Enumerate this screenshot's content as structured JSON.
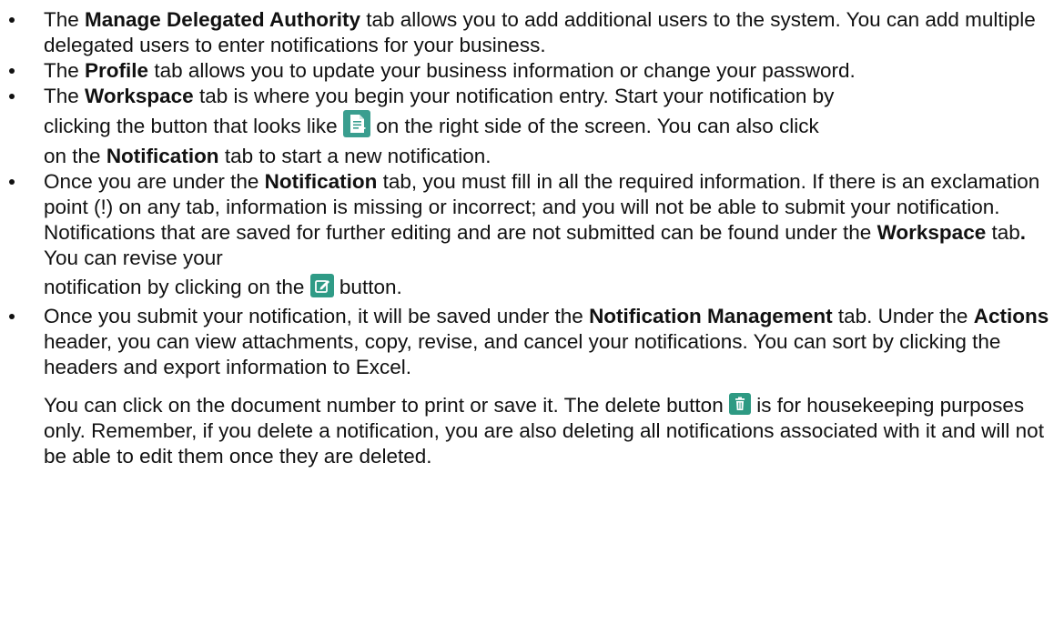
{
  "bullets": [
    {
      "before": "The ",
      "bold": "Manage Delegated Authority",
      "after": " tab allows you to add additional users to the system. You can add multiple delegated users to enter notifications for your business."
    },
    {
      "before": "The ",
      "bold": "Profile",
      "after": " tab allows you to update your business information or change your password."
    },
    {
      "line1_before": "The ",
      "line1_bold": "Workspace",
      "line1_after": " tab is where you begin your notification entry.  Start your notification by",
      "line2_before": "clicking the button that looks like ",
      "line2_after": " on the right side of the screen.  You can also click",
      "line3_before": "on the ",
      "line3_bold": "Notification",
      "line3_after": " tab to start a new notification."
    },
    {
      "seg1": "Once you are under the ",
      "bold1": "Notification",
      "seg2": " tab, you must fill in all the required information.  If there is an exclamation point (!) on any tab, information is missing or incorrect; and you will not be able to submit your notification.  Notifications that are saved for further editing and are not submitted can be found under the ",
      "bold2": "Workspace",
      "seg3": " tab",
      "bold3": ".",
      "seg4": "  You can revise your",
      "line_last_before": "notification by clicking on the ",
      "line_last_after": " button."
    },
    {
      "seg1": "Once you submit your notification, it will be saved under the ",
      "bold1": "Notification Management",
      "seg2": " tab.  Under the ",
      "bold2": "Actions",
      "seg3": " header, you can view attachments, copy, revise, and cancel your notifications.  You can sort by clicking the headers and export information to Excel.",
      "para2_before": "You can click on the document number to print or save it.  The delete button ",
      "para2_after": " is for housekeeping purposes only.  Remember, if you delete a notification, you are also deleting all notifications associated with it and will not be able to edit them once they are deleted."
    }
  ],
  "icons": {
    "new_notification": "new-notification-icon",
    "edit": "edit-icon",
    "delete": "trash-icon"
  },
  "colors": {
    "icon_teal": "#2f9b86"
  }
}
